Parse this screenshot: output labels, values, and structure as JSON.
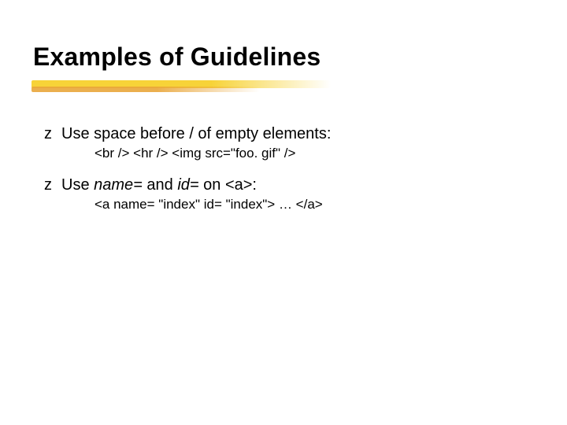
{
  "slide": {
    "title": "Examples of Guidelines",
    "bullets": [
      {
        "marker": "z",
        "text_before": "Use space before / of empty elements:",
        "sub": "<br /> <hr /> <img src=\"foo. gif\" />"
      },
      {
        "marker": "z",
        "text_parts": {
          "p1": "Use ",
          "i1": "name=",
          "p2": " and ",
          "i2": "id=",
          "p3": " on <a>:"
        },
        "sub": "<a name= \"index\" id= \"index\"> … </a>"
      }
    ]
  }
}
